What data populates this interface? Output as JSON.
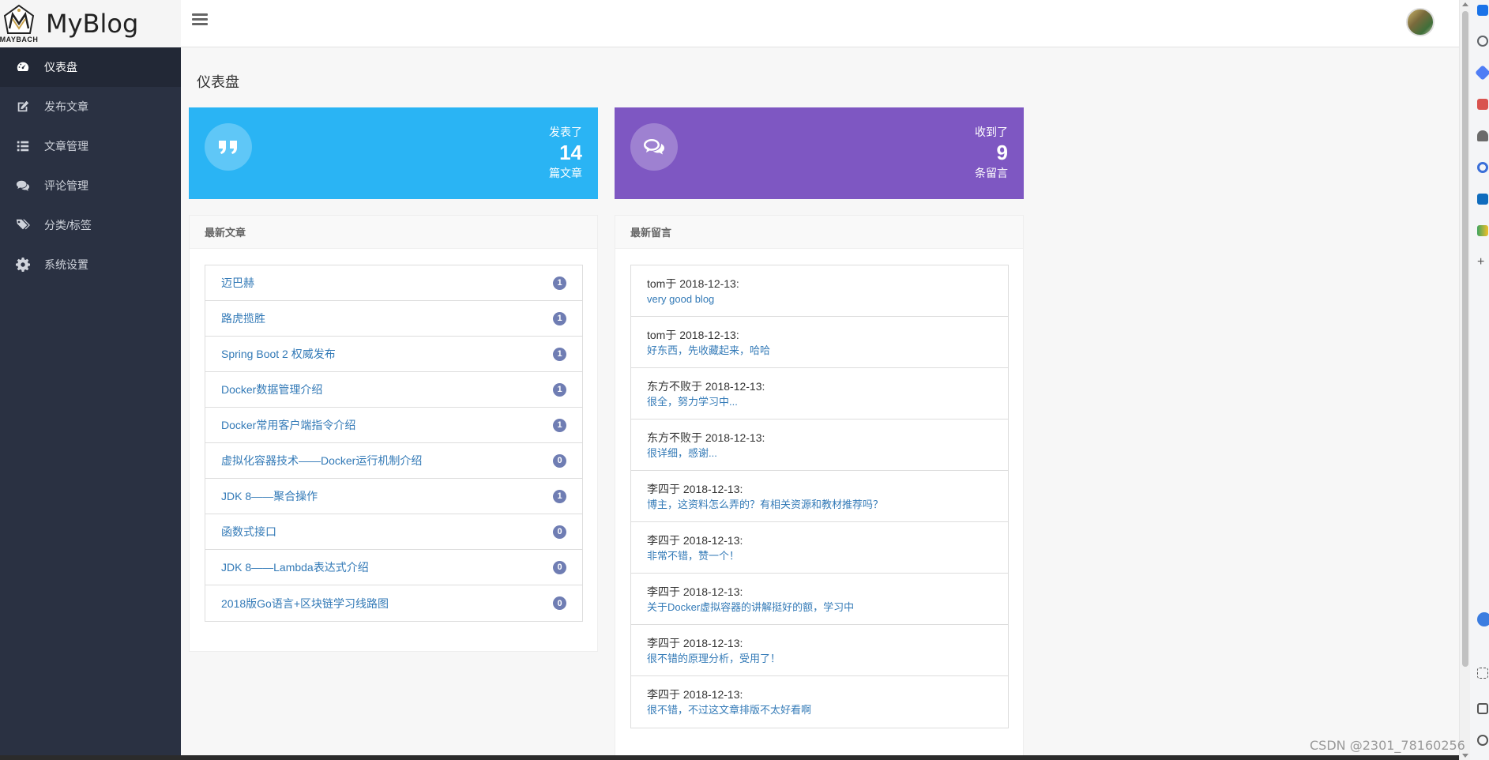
{
  "app": {
    "brand": "MyBlog",
    "logo_text": "MAYBACH"
  },
  "sidebar": {
    "items": [
      {
        "label": "仪表盘",
        "icon": "dashboard-icon",
        "active": true
      },
      {
        "label": "发布文章",
        "icon": "edit-icon",
        "active": false
      },
      {
        "label": "文章管理",
        "icon": "list-icon",
        "active": false
      },
      {
        "label": "评论管理",
        "icon": "comments-icon",
        "active": false
      },
      {
        "label": "分类/标签",
        "icon": "tags-icon",
        "active": false
      },
      {
        "label": "系统设置",
        "icon": "gear-icon",
        "active": false
      }
    ]
  },
  "page": {
    "title": "仪表盘"
  },
  "stats": {
    "articles": {
      "line1": "发表了",
      "value": "14",
      "line2": "篇文章",
      "color": "#2ab4f4",
      "icon": "quote-icon"
    },
    "comments": {
      "line1": "收到了",
      "value": "9",
      "line2": "条留言",
      "color": "#7e57c2",
      "icon": "comments-icon"
    }
  },
  "latest_articles": {
    "title": "最新文章",
    "items": [
      {
        "title": "迈巴赫",
        "count": "1"
      },
      {
        "title": "路虎揽胜",
        "count": "1"
      },
      {
        "title": "Spring Boot 2 权威发布",
        "count": "1"
      },
      {
        "title": "Docker数据管理介绍",
        "count": "1"
      },
      {
        "title": "Docker常用客户端指令介绍",
        "count": "1"
      },
      {
        "title": "虚拟化容器技术——Docker运行机制介绍",
        "count": "0"
      },
      {
        "title": "JDK 8——聚合操作",
        "count": "1"
      },
      {
        "title": "函数式接口",
        "count": "0"
      },
      {
        "title": "JDK 8——Lambda表达式介绍",
        "count": "0"
      },
      {
        "title": "2018版Go语言+区块链学习线路图",
        "count": "0"
      }
    ]
  },
  "latest_comments": {
    "title": "最新留言",
    "items": [
      {
        "author": "tom于 2018-12-13:",
        "text": "very good blog"
      },
      {
        "author": "tom于 2018-12-13:",
        "text": "好东西，先收藏起来，哈哈"
      },
      {
        "author": "东方不败于 2018-12-13:",
        "text": "很全，努力学习中..."
      },
      {
        "author": "东方不败于 2018-12-13:",
        "text": "很详细，感谢..."
      },
      {
        "author": "李四于 2018-12-13:",
        "text": "博主，这资料怎么弄的？有相关资源和教材推荐吗？"
      },
      {
        "author": "李四于 2018-12-13:",
        "text": "非常不错，赞一个！"
      },
      {
        "author": "李四于 2018-12-13:",
        "text": "关于Docker虚拟容器的讲解挺好的额，学习中"
      },
      {
        "author": "李四于 2018-12-13:",
        "text": "很不错的原理分析，受用了！"
      },
      {
        "author": "李四于 2018-12-13:",
        "text": "很不错，不过这文章排版不太好看啊"
      }
    ]
  },
  "watermark": "CSDN @2301_78160256"
}
